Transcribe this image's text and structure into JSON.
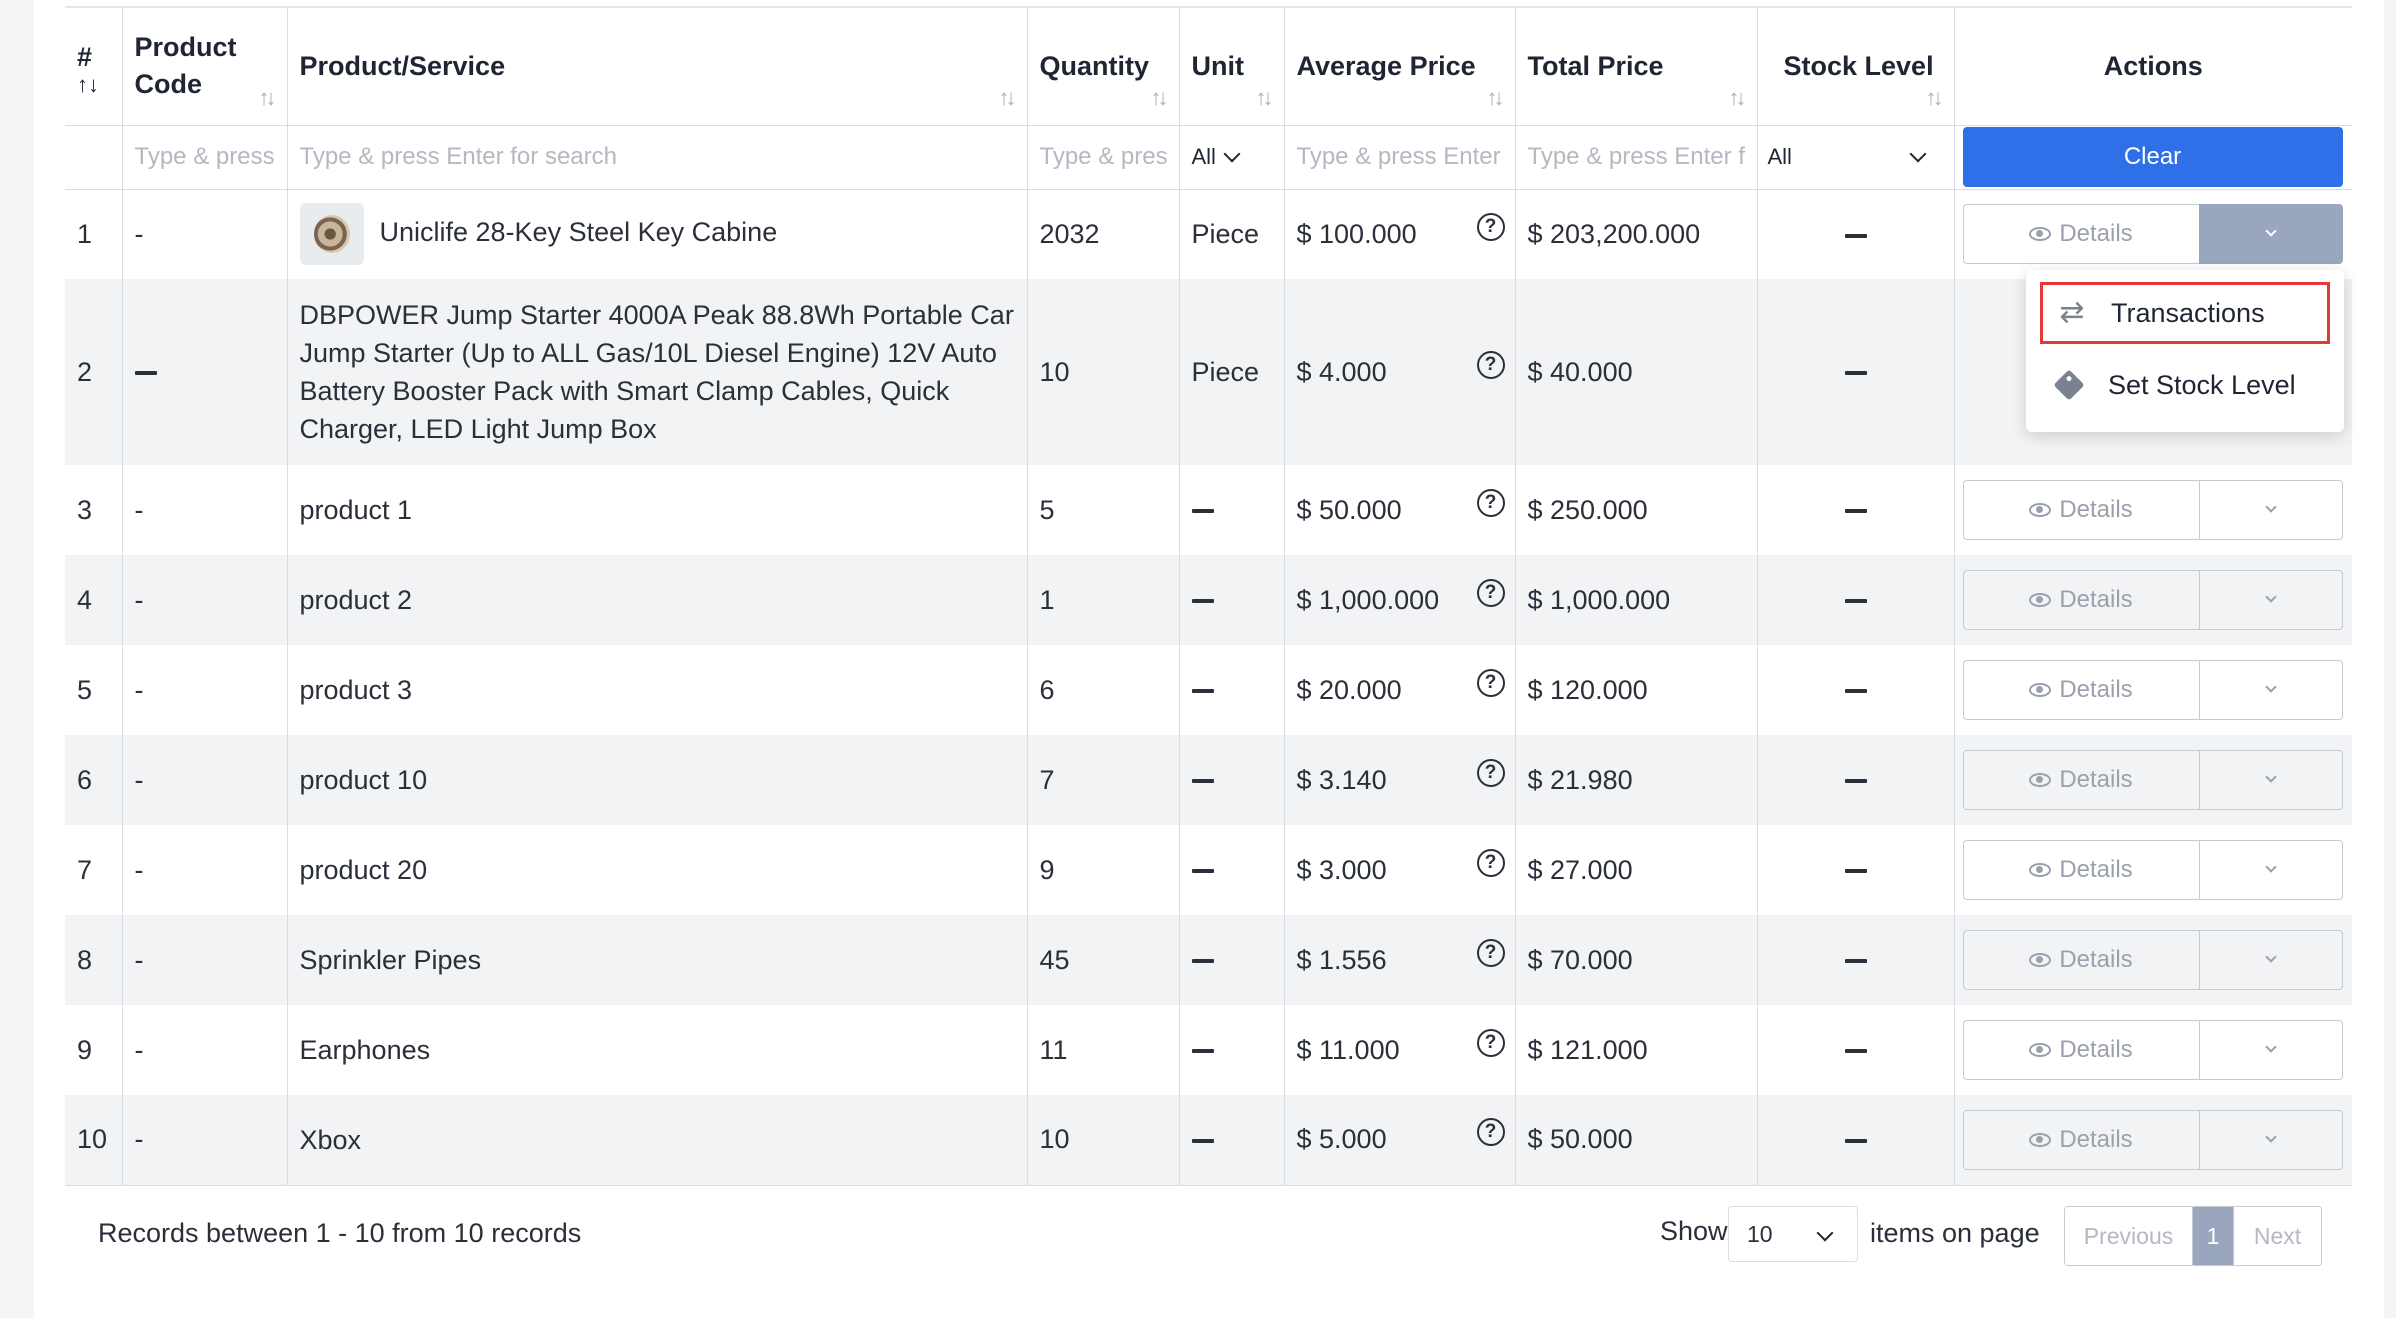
{
  "table": {
    "columns": [
      {
        "label": "#"
      },
      {
        "label": "Product Code"
      },
      {
        "label": "Product/Service"
      },
      {
        "label": "Quantity"
      },
      {
        "label": "Unit"
      },
      {
        "label": "Average Price"
      },
      {
        "label": "Total Price"
      },
      {
        "label": "Stock Level"
      },
      {
        "label": "Actions"
      }
    ],
    "filters": {
      "code_placeholder": "Type & press",
      "product_placeholder": "Type & press Enter for search",
      "quantity_placeholder": "Type & press",
      "unit_value": "All",
      "avg_placeholder": "Type & press Enter",
      "total_placeholder": "Type & press Enter fo",
      "stock_value": "All",
      "clear_label": "Clear"
    },
    "rows": [
      {
        "n": "1",
        "code": "-",
        "product": "Uniclife 28-Key Steel Key Cabine",
        "quantity": "2032",
        "unit": "Piece",
        "avg": "$ 100.000",
        "total": "$ 203,200.000"
      },
      {
        "n": "2",
        "code": "",
        "product": "DBPOWER Jump Starter 4000A Peak 88.8Wh Portable Car Jump Starter (Up to ALL Gas/10L Diesel Engine) 12V Auto Battery Booster Pack with Smart Clamp Cables, Quick Charger, LED Light Jump Box",
        "quantity": "10",
        "unit": "Piece",
        "avg": "$ 4.000",
        "total": "$ 40.000"
      },
      {
        "n": "3",
        "code": "-",
        "product": "product 1",
        "quantity": "5",
        "unit": "",
        "avg": "$ 50.000",
        "total": "$ 250.000"
      },
      {
        "n": "4",
        "code": "-",
        "product": "product 2",
        "quantity": "1",
        "unit": "",
        "avg": "$ 1,000.000",
        "total": "$ 1,000.000"
      },
      {
        "n": "5",
        "code": "-",
        "product": "product 3",
        "quantity": "6",
        "unit": "",
        "avg": "$ 20.000",
        "total": "$ 120.000"
      },
      {
        "n": "6",
        "code": "-",
        "product": "product 10",
        "quantity": "7",
        "unit": "",
        "avg": "$ 3.140",
        "total": "$ 21.980"
      },
      {
        "n": "7",
        "code": "-",
        "product": "product 20",
        "quantity": "9",
        "unit": "",
        "avg": "$ 3.000",
        "total": "$ 27.000"
      },
      {
        "n": "8",
        "code": "-",
        "product": "Sprinkler Pipes",
        "quantity": "45",
        "unit": "",
        "avg": "$ 1.556",
        "total": "$ 70.000"
      },
      {
        "n": "9",
        "code": "-",
        "product": "Earphones",
        "quantity": "11",
        "unit": "",
        "avg": "$ 11.000",
        "total": "$ 121.000"
      },
      {
        "n": "10",
        "code": "-",
        "product": "Xbox",
        "quantity": "10",
        "unit": "",
        "avg": "$ 5.000",
        "total": "$ 50.000"
      }
    ],
    "details_label": "Details",
    "help_glyph": "?"
  },
  "menu": {
    "items": [
      {
        "label": "Transactions",
        "icon": "swap-arrows-icon"
      },
      {
        "label": "Set Stock Level",
        "icon": "tag-icon"
      }
    ]
  },
  "footer": {
    "records_text": "Records between 1 - 10 from 10 records",
    "show_label": "Show",
    "page_size": "10",
    "items_on_page": "items on page",
    "previous": "Previous",
    "current_page": "1",
    "next": "Next"
  },
  "colors": {
    "primary": "#2f6fe8",
    "highlight_border": "#e53935",
    "active_page": "#9aa6bd"
  }
}
